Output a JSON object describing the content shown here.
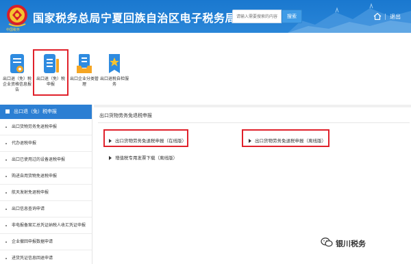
{
  "header": {
    "title": "国家税务总局宁夏回族自治区电子税务局",
    "emblem_text": "中国税务",
    "search_placeholder": "请输入需要搜索的内容",
    "search_button": "搜索",
    "logout": "退出"
  },
  "apps": [
    {
      "label": "出口退（免）税企业资格信息报告",
      "icon": "document-icon"
    },
    {
      "label": "出口退（免）税申报",
      "icon": "form-icon"
    },
    {
      "label": "出口企业分类管理",
      "icon": "inbox-icon"
    },
    {
      "label": "出口退税自检服务",
      "icon": "star-bookmark-icon"
    }
  ],
  "sidebar": {
    "heading": "出口退（免）税申报",
    "items": [
      "出口货物劳务免退税申报",
      "代办退税申报",
      "出口已使用过的设备退税申报",
      "购进自用货物免退税申报",
      "航天发射免退税申报",
      "出口信息查询申请",
      "非电报备案汇总凭证纳税人收汇凭证申报",
      "企业撤回申报数据申请",
      "进货凭证信息回退申请"
    ]
  },
  "main": {
    "title": "出口货物劳务免退税申报",
    "links": {
      "online": "出口货物劳务免退税申报（在线版）",
      "offline": "出口货物劳务免退税申报（离线版）",
      "vat_invoice": "增值税专用发票下载（离线版）"
    }
  },
  "watermark": "银川税务",
  "colors": {
    "header_blue": "#1a78cf",
    "sidebar_blue": "#2c7fd3",
    "highlight_red": "#e0202a"
  }
}
